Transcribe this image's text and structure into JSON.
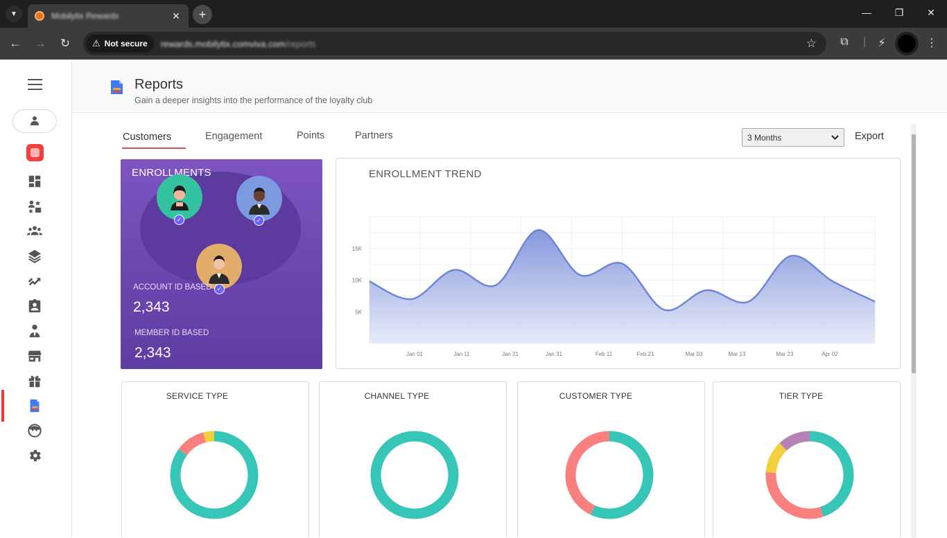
{
  "browser": {
    "tab_title": "Mobilytix Rewards",
    "close_glyph": "✕",
    "new_tab_glyph": "+",
    "security_label": "Not secure",
    "url_host": "rewards.mobilytix.comviva.com",
    "url_path": "/reports",
    "window": {
      "minimize": "—",
      "maximize": "❐",
      "close": "✕"
    }
  },
  "header": {
    "title": "Reports",
    "subtitle": "Gain a deeper insights into the performance of the loyalty club"
  },
  "tabs": [
    {
      "label": "Customers",
      "active": true
    },
    {
      "label": "Engagement",
      "active": false
    },
    {
      "label": "Points",
      "active": false
    },
    {
      "label": "Partners",
      "active": false
    }
  ],
  "range_select": {
    "value": "3 Months"
  },
  "export_label": "Export",
  "sidebar": {
    "items": [
      "dashboard-icon",
      "members-reward-icon",
      "groups-icon",
      "layers-icon",
      "exchange-icon",
      "assignment-icon",
      "person-tie-icon",
      "store-icon",
      "gift-icon",
      "report-icon",
      "face-icon",
      "settings-icon"
    ],
    "active_item": "report-icon"
  },
  "enrollments": {
    "title": "ENROLLMENTS",
    "account_label": "ACCOUNT ID BASED",
    "account_value": "2,343",
    "member_label": "MEMBER ID BASED",
    "member_value": "2,343"
  },
  "colors": {
    "teal": "#36c6b8",
    "coral": "#fa7f7f",
    "yellow": "#f2cf3b",
    "mauve": "#b583b3",
    "purple": "#7d54c0",
    "accent_red": "#f03a3a",
    "trend_line": "#6f86d6"
  },
  "chart_data": [
    {
      "type": "area",
      "title": "ENROLLMENT TREND",
      "x_ticks": [
        "Jan 01",
        "Jan 11",
        "Jan 21",
        "Jan 31",
        "Feb 11",
        "Feb 21",
        "Mar 03",
        "Mar 13",
        "Mar 23",
        "Apr 02"
      ],
      "y_ticks": [
        "5K",
        "10K",
        "15K"
      ],
      "ylim": [
        0,
        20000
      ],
      "grid": true,
      "x": [
        "Dec 28",
        "Jan 04",
        "Jan 13",
        "Jan 22",
        "Jan 31",
        "Feb 09",
        "Feb 18",
        "Feb 27",
        "Mar 07",
        "Mar 16",
        "Mar 25",
        "Apr 02",
        "Apr 08"
      ],
      "values": [
        9800,
        7000,
        11600,
        9200,
        17900,
        10800,
        12600,
        5300,
        8400,
        6600,
        13800,
        9800,
        6600
      ]
    },
    {
      "type": "pie",
      "title": "SERVICE TYPE",
      "values": [
        85,
        11,
        4
      ],
      "colors": [
        "#36c6b8",
        "#fa7f7f",
        "#f2cf3b"
      ]
    },
    {
      "type": "pie",
      "title": "CHANNEL TYPE",
      "values": [
        100
      ],
      "colors": [
        "#36c6b8"
      ]
    },
    {
      "type": "pie",
      "title": "CUSTOMER TYPE",
      "values": [
        57,
        43
      ],
      "colors": [
        "#36c6b8",
        "#fa7f7f"
      ]
    },
    {
      "type": "pie",
      "title": "TIER TYPE",
      "values": [
        45,
        31,
        12,
        12
      ],
      "colors": [
        "#36c6b8",
        "#fa7f7f",
        "#f2cf3b",
        "#b583b3"
      ]
    }
  ]
}
